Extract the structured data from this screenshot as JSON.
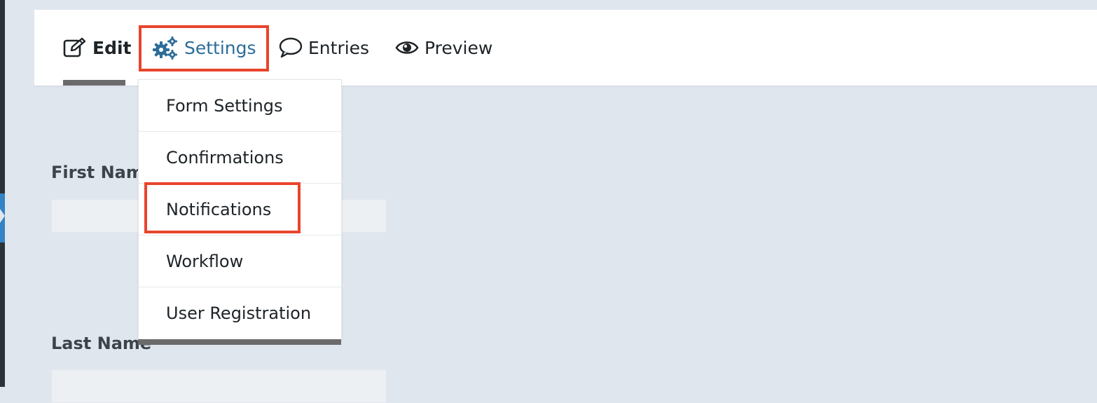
{
  "toolbar": {
    "tabs": [
      {
        "label": "Edit",
        "icon": "edit-icon"
      },
      {
        "label": "Settings",
        "icon": "gears-icon"
      },
      {
        "label": "Entries",
        "icon": "comment-icon"
      },
      {
        "label": "Preview",
        "icon": "eye-icon"
      }
    ],
    "active_tab": "Edit",
    "highlighted_tab": "Settings"
  },
  "settings_menu": {
    "items": [
      {
        "label": "Form Settings"
      },
      {
        "label": "Confirmations"
      },
      {
        "label": "Notifications"
      },
      {
        "label": "Workflow"
      },
      {
        "label": "User Registration"
      }
    ],
    "highlighted_item": "Notifications"
  },
  "form": {
    "fields": [
      {
        "label": "First Name",
        "required": false,
        "value": ""
      },
      {
        "label": "Last Name",
        "required_marker": "*",
        "value": ""
      }
    ]
  },
  "colors": {
    "highlight": "#e8452c",
    "settings_link": "#2c6d98",
    "required": "#c02b0a",
    "page_background": "#e0e6ee"
  }
}
